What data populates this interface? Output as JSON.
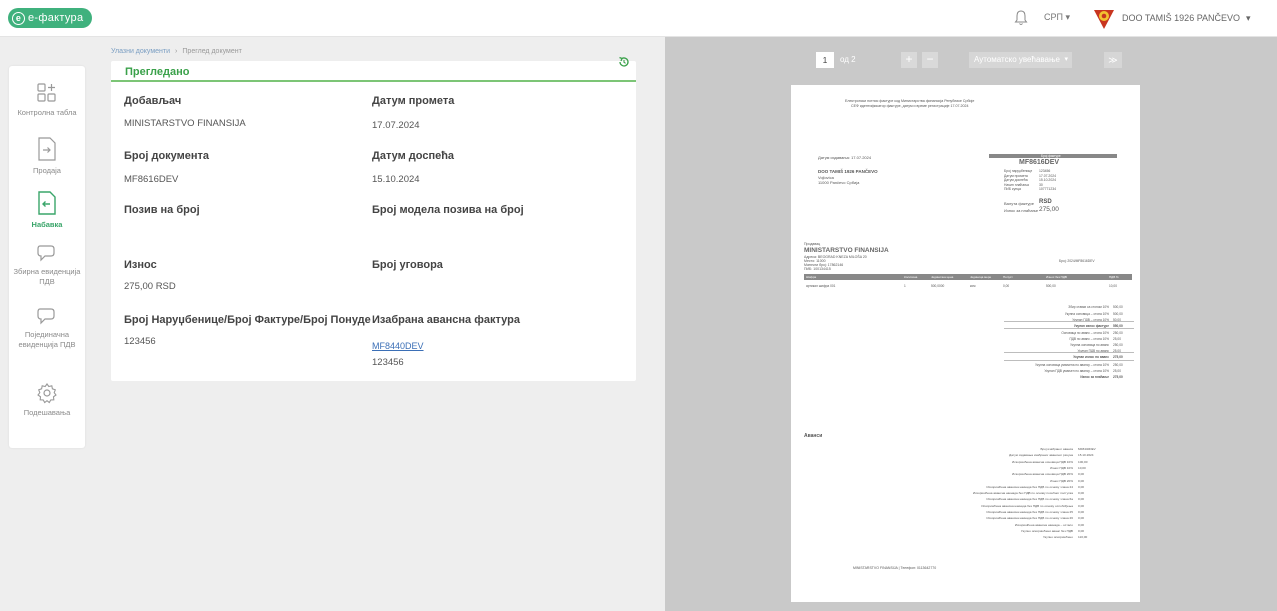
{
  "topbar": {
    "logo_text": "е-фактура",
    "language": "СРП",
    "company_name": "DOO TAMIŠ 1926 PANČEVO"
  },
  "sidebar": {
    "items": [
      {
        "label": "Контролна табла",
        "icon": "dashboard-icon",
        "active": false
      },
      {
        "label": "Продаја",
        "icon": "sales-icon",
        "active": false
      },
      {
        "label": "Набавка",
        "icon": "purchase-icon",
        "active": true
      },
      {
        "label": "Збирна евиденција ПДВ",
        "icon": "chat-icon",
        "active": false
      },
      {
        "label": "Појединачна евиденција ПДВ",
        "icon": "chat-icon",
        "active": false
      },
      {
        "label": "Подешавања",
        "icon": "gear-icon",
        "active": false
      }
    ]
  },
  "breadcrumb": {
    "parent": "Улазни документи",
    "current": "Преглед документ"
  },
  "status": "Прегледано",
  "fields": {
    "supplier_label": "Добављач",
    "supplier_value": "MINISTARSTVO FINANSIJA",
    "turnover_date_label": "Датум промета",
    "turnover_date_value": "17.07.2024",
    "doc_number_label": "Број документа",
    "doc_number_value": "MF8616DEV",
    "due_date_label": "Датум доспећа",
    "due_date_value": "15.10.2024",
    "reference_label": "Позив на број",
    "reference_value": "",
    "reference_model_label": "Број модела позива на број",
    "reference_model_value": "",
    "amount_label": "Износ",
    "amount_value": "275,00 RSD",
    "contract_label": "Број уговора",
    "contract_value": "",
    "order_label": "Број Наруџбенице/Број Фактуре/Број Понуде",
    "order_value": "123456",
    "advance_label": "Изабрана авансна фактура",
    "advance_link": "MF8440DEV",
    "advance_value": "123456"
  },
  "viewer": {
    "page_current": "1",
    "page_of": "од 2",
    "zoom_label": "Аутоматско увећавање",
    "zoom_in": "+",
    "zoom_out": "−",
    "forward": "≫"
  },
  "pdf": {
    "header_line1": "Електронски потпис фактуре код Министарства финансија Републике Србије",
    "header_line2": "СЕФ идентификатор фактуре, датум и време регистрације 17.07.2024",
    "issue_date": "Датум издавања: 17.07.2024",
    "buyer_name": "DOO TAMIŠ 1926 PANČEVO",
    "buyer_street": "Vojlovica",
    "buyer_city": "11000 Pančevo Србија",
    "invoice_title": "Број фактуре",
    "invoice_number": "MF8616DEV",
    "invoice_meta": [
      {
        "k": "Број наруџбенице",
        "v": "123456"
      },
      {
        "k": "Датум промета",
        "v": "17.07.2024"
      },
      {
        "k": "Датум доспећа",
        "v": "15.10.2024"
      },
      {
        "k": "Начин плаћања",
        "v": "30"
      },
      {
        "k": "ПИБ купца",
        "v": "107771234"
      }
    ],
    "currency_label": "Валута фактуре",
    "currency_value": "RSD",
    "total_label": "Износ за плаћање",
    "total_value": "275,00",
    "seller_caption": "Продавац",
    "seller_name": "MINISTARSTVO FINANSIJA",
    "seller_address": "Адреса: BEOGRAD KNEZA MILOŠA 20",
    "seller_city": "Место: 11000",
    "seller_account": "Матични број: 17862146",
    "seller_pib": "ПИБ: 100134415",
    "seller_ref": "Број: 2024/MF8616DEV",
    "table_headers": [
      "Шифра",
      "Количина",
      "Јединична цена",
      "Јединица мере",
      "Попуст",
      "Износ без ПДВ",
      "ПДВ %"
    ],
    "table_row": [
      "артикал шифра 001",
      "1",
      "500,0000",
      "ком",
      "0,00",
      "500,00",
      "10,00"
    ],
    "sum_rows": [
      {
        "k": "Збир ставки са стопом 10%",
        "v": "500,00"
      },
      {
        "k": "Укупна основица – стопа 10%",
        "v": "500,00"
      },
      {
        "k": "Укупан ПДВ – стопа 10%",
        "v": "50,00"
      },
      {
        "k": "Укупан износ фактуре",
        "v": "550,00"
      },
      {
        "k": "Основица по аванс – стопа 10%",
        "v": "250,00"
      },
      {
        "k": "ПДВ по аванс – стопа 10%",
        "v": "25,00"
      },
      {
        "k": "Укупна основица по аванс",
        "v": "250,00"
      },
      {
        "k": "Укупан ПДВ по аванс",
        "v": "25,00"
      },
      {
        "k": "Укупан износ по аванс",
        "v": "275,00"
      },
      {
        "k": "Укупна основица умањена по авансу – стопа 10%",
        "v": "250,00"
      },
      {
        "k": "Укупан ПДВ умањен по авансу – стопа 10%",
        "v": "25,00"
      },
      {
        "k": "Износ за плаћање",
        "v": "275,00"
      }
    ],
    "advances_title": "Аванси",
    "advance_rows": [
      {
        "k": "Број изабраног аванса",
        "v": "MF8440DEV"
      },
      {
        "k": "Датум издавања изабраног авансног рачуна",
        "v": "15.10.2024"
      },
      {
        "k": "Искоришћена авансна основица ПДВ 10%",
        "v": "100,00"
      },
      {
        "k": "Износ ПДВ 10%",
        "v": "10,00"
      },
      {
        "k": "Искоришћена авансна основица ПДВ 20%",
        "v": "0,00"
      },
      {
        "k": "Износ ПДВ 20%",
        "v": "0,00"
      },
      {
        "k": "Искоришћена авансна накнада без ПДВ по основу члана 24",
        "v": "0,00"
      },
      {
        "k": "Искоришћена авансна накнада без ПДВ по основу посебног поступка",
        "v": "0,00"
      },
      {
        "k": "Искоришћена авансна накнада без ПДВ по основу члана 6а",
        "v": "0,00"
      },
      {
        "k": "Искоришћена авансна накнада без ПДВ по основу ослобођења",
        "v": "0,00"
      },
      {
        "k": "Искоришћена авансна накнада без ПДВ по основу члана 25",
        "v": "0,00"
      },
      {
        "k": "Искоришћена авансна накнада без ПДВ по основу члана 26",
        "v": "0,00"
      },
      {
        "k": "Искоришћена авансна накнада – остало",
        "v": "0,00"
      },
      {
        "k": "Укупно искоришћени аванс без ПДВ",
        "v": "0,00"
      },
      {
        "k": "Укупно искоришћено",
        "v": "110,00"
      }
    ],
    "footer": "MINISTARSTVO FINANSIJA | Телефон: 0113642770"
  },
  "colors": {
    "brand_green": "#3fb17d",
    "status_green": "#3aa14a",
    "link_blue": "#3b6fb6",
    "viewer_bg": "#c9c9c9"
  }
}
